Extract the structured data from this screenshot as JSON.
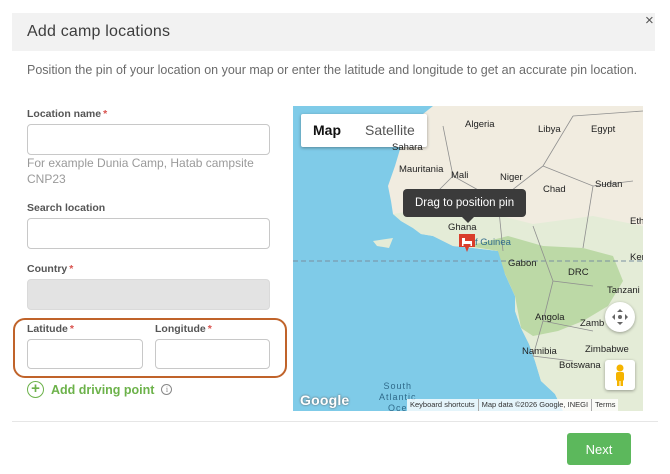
{
  "modal": {
    "title": "Add camp locations",
    "close_glyph": "×",
    "instructions": "Position the pin of your location on your map or enter the latitude and longitude to get an accurate pin location."
  },
  "form": {
    "required_marker": "*",
    "location_name": {
      "label": "Location name",
      "value": "",
      "hint": "For example Dunia Camp, Hatab campsite CNP23"
    },
    "search_location": {
      "label": "Search location",
      "value": ""
    },
    "country": {
      "label": "Country",
      "value": "",
      "disabled": true
    },
    "latitude": {
      "label": "Latitude",
      "value": ""
    },
    "longitude": {
      "label": "Longitude",
      "value": ""
    },
    "add_driving_point": {
      "label": "Add driving point",
      "icon": "plus-circle-icon",
      "info_icon": "info-icon",
      "info_glyph": "i"
    }
  },
  "map": {
    "type_controls": {
      "map_label": "Map",
      "satellite_label": "Satellite",
      "selected": "Map"
    },
    "tooltip": "Drag to position pin",
    "pin_icon": "bed-marker-icon",
    "country_labels": {
      "algeria": "Algeria",
      "libya": "Libya",
      "egypt": "Egypt",
      "sahara": "Sahara",
      "mauritania": "Mauritania",
      "mali": "Mali",
      "niger": "Niger",
      "chad": "Chad",
      "sudan": "Sudan",
      "ghana": "Ghana",
      "gulf": "f Guinea",
      "ethiopia": "Eth",
      "kenya": "Ken",
      "gabon": "Gabon",
      "drc": "DRC",
      "tanzania": "Tanzani",
      "angola": "Angola",
      "zambia": "Zamb",
      "namibia": "Namibia",
      "zimbabwe": "Zimbabwe",
      "botswana": "Botswana"
    },
    "ocean_label": {
      "line1": "South",
      "line2": "Atlantic",
      "line3": "Oce"
    },
    "google_logo": "Google",
    "attribution": {
      "keyboard": "Keyboard shortcuts",
      "data": "Map data ©2026 Google, INEGI",
      "terms": "Terms"
    },
    "controls": {
      "fullscreen_icon": "move-arrows-icon",
      "pegman_icon": "pegman-icon"
    },
    "colors": {
      "ocean": "#7fcbe8",
      "land": "#e4ecd7",
      "land_green": "#bcd9a6",
      "desert": "#f1ece0",
      "pin": "#d93d2b"
    }
  },
  "footer": {
    "next_label": "Next",
    "next_color": "#5cb85c"
  }
}
